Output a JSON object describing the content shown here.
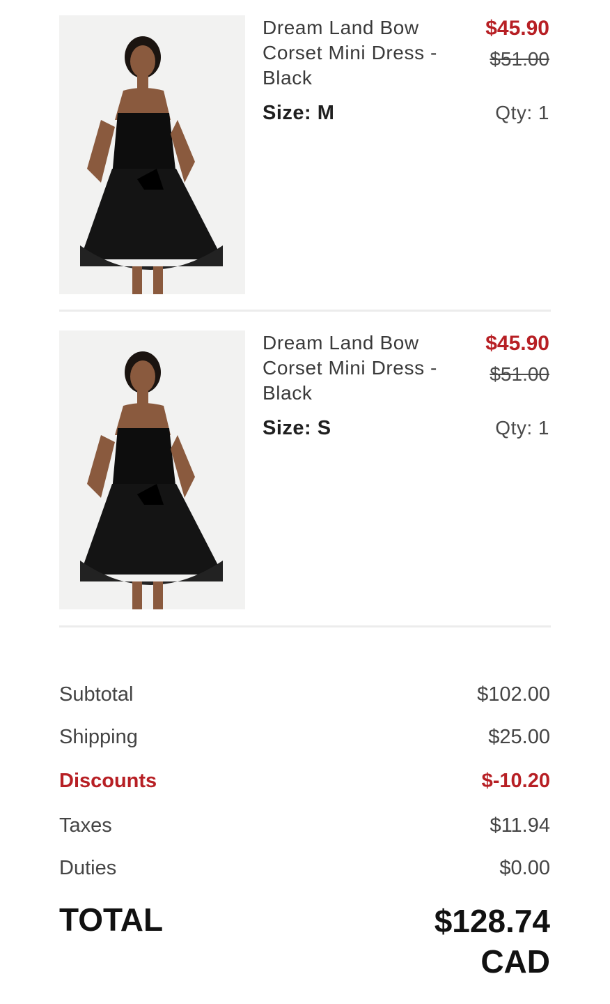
{
  "items": [
    {
      "name": "Dream Land Bow Corset Mini Dress - Black",
      "size_label": "Size:",
      "size": "M",
      "price_sale": "$45.90",
      "price_original": "$51.00",
      "qty_label": "Qty:",
      "qty": "1"
    },
    {
      "name": "Dream Land Bow Corset Mini Dress - Black",
      "size_label": "Size:",
      "size": "S",
      "price_sale": "$45.90",
      "price_original": "$51.00",
      "qty_label": "Qty:",
      "qty": "1"
    }
  ],
  "summary": {
    "subtotal_label": "Subtotal",
    "subtotal": "$102.00",
    "shipping_label": "Shipping",
    "shipping": "$25.00",
    "discounts_label": "Discounts",
    "discounts": "$-10.20",
    "taxes_label": "Taxes",
    "taxes": "$11.94",
    "duties_label": "Duties",
    "duties": "$0.00",
    "total_label": "TOTAL",
    "total": "$128.74",
    "currency": "CAD"
  },
  "colors": {
    "sale": "#b71f24",
    "text": "#333333",
    "divider": "#ececec"
  }
}
